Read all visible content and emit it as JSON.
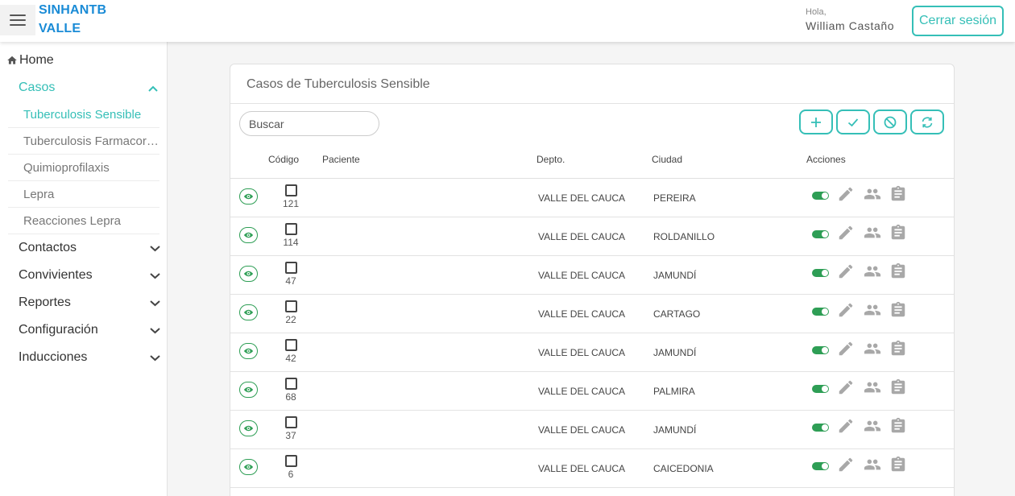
{
  "header": {
    "brand_line1": "SINHANTB",
    "brand_line2": "VALLE",
    "greeting": "Hola,",
    "username": "William Castaño",
    "logout_label": "Cerrar sesión"
  },
  "sidebar": {
    "home_label": "Home",
    "casos_label": "Casos",
    "casos_items": [
      {
        "label": "Tuberculosis Sensible",
        "active": true
      },
      {
        "label": "Tuberculosis Farmacorresistente",
        "active": false
      },
      {
        "label": "Quimioprofilaxis",
        "active": false
      },
      {
        "label": "Lepra",
        "active": false
      },
      {
        "label": "Reacciones Lepra",
        "active": false
      }
    ],
    "groups": [
      {
        "label": "Contactos"
      },
      {
        "label": "Convivientes"
      },
      {
        "label": "Reportes"
      },
      {
        "label": "Configuración"
      },
      {
        "label": "Inducciones"
      }
    ]
  },
  "main": {
    "title": "Casos de Tuberculosis Sensible",
    "search_placeholder": "Buscar",
    "toolbar_icons": [
      "add-icon",
      "check-icon",
      "block-icon",
      "sync-icon"
    ],
    "columns": {
      "codigo": "Código",
      "paciente": "Paciente",
      "depto": "Depto.",
      "ciudad": "Ciudad",
      "acciones": "Acciones"
    },
    "rows": [
      {
        "codigo": "121",
        "depto": "VALLE DEL CAUCA",
        "ciudad": "PEREIRA"
      },
      {
        "codigo": "114",
        "depto": "VALLE DEL CAUCA",
        "ciudad": "ROLDANILLO"
      },
      {
        "codigo": "47",
        "depto": "VALLE DEL CAUCA",
        "ciudad": "JAMUNDÍ"
      },
      {
        "codigo": "22",
        "depto": "VALLE DEL CAUCA",
        "ciudad": "CARTAGO"
      },
      {
        "codigo": "42",
        "depto": "VALLE DEL CAUCA",
        "ciudad": "JAMUNDÍ"
      },
      {
        "codigo": "68",
        "depto": "VALLE DEL CAUCA",
        "ciudad": "PALMIRA"
      },
      {
        "codigo": "37",
        "depto": "VALLE DEL CAUCA",
        "ciudad": "JAMUNDÍ"
      },
      {
        "codigo": "6",
        "depto": "VALLE DEL CAUCA",
        "ciudad": "CAICEDONIA"
      }
    ]
  },
  "colors": {
    "accent": "#35bfb7",
    "brand": "#1a8bd6",
    "success": "#2e9e55",
    "icon_gray": "#a8a8a8"
  }
}
